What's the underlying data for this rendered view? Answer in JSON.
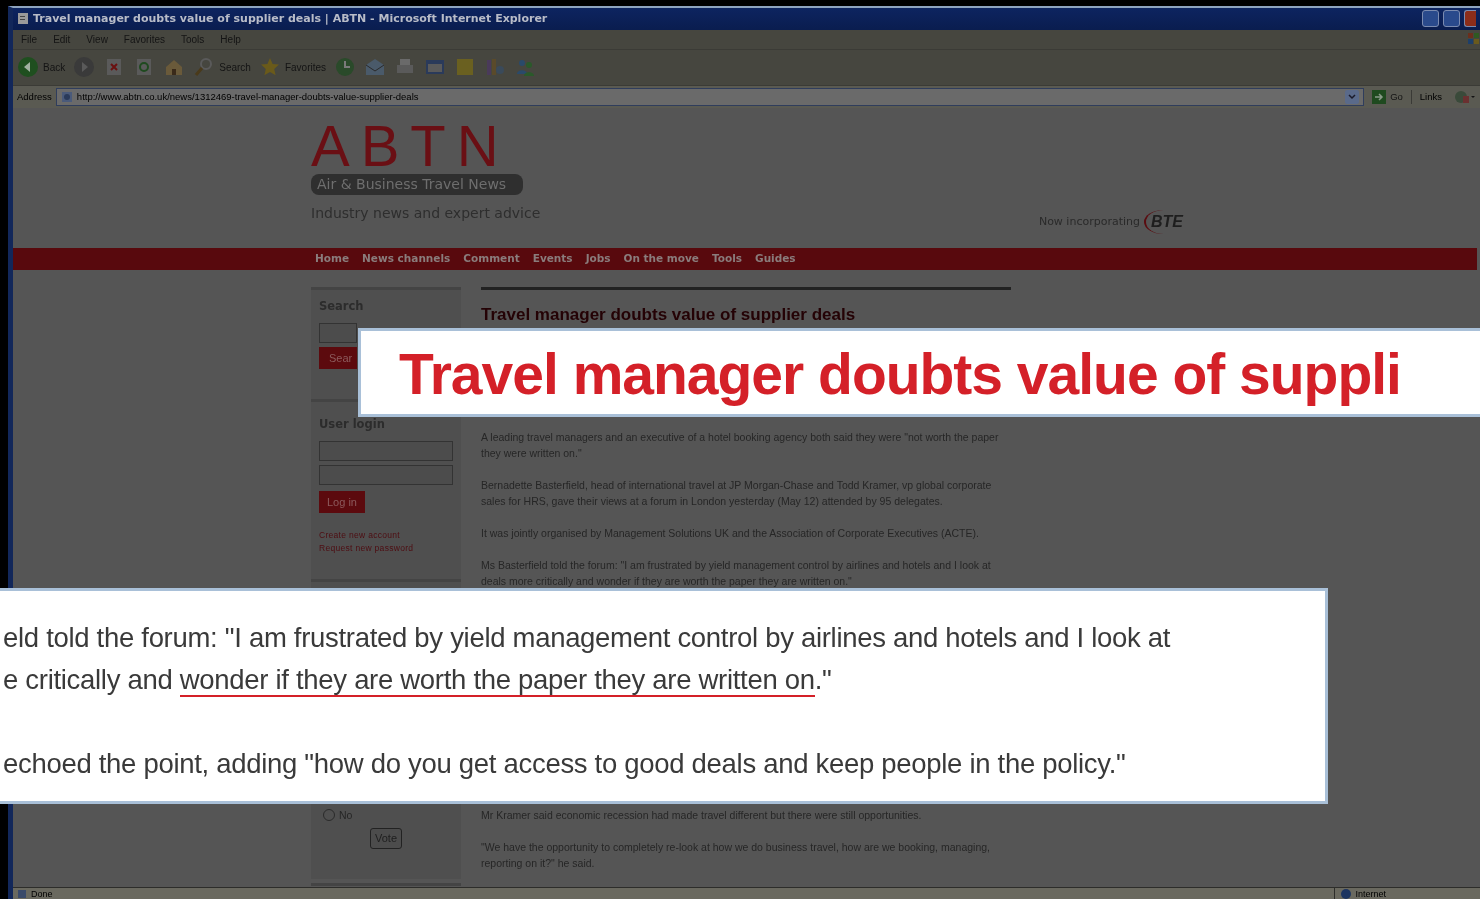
{
  "window": {
    "title": "Travel manager doubts value of supplier deals | ABTN - Microsoft Internet Explorer"
  },
  "menu": [
    "File",
    "Edit",
    "View",
    "Favorites",
    "Tools",
    "Help"
  ],
  "toolbar": [
    {
      "kind": "back",
      "label": "Back"
    },
    {
      "kind": "forward"
    },
    {
      "kind": "stop"
    },
    {
      "kind": "refresh"
    },
    {
      "kind": "home"
    },
    {
      "kind": "search",
      "label": "Search"
    },
    {
      "kind": "favorites",
      "label": "Favorites"
    },
    {
      "kind": "history"
    },
    {
      "kind": "mail"
    },
    {
      "kind": "print"
    },
    {
      "kind": "edit"
    },
    {
      "kind": "note"
    },
    {
      "kind": "research"
    },
    {
      "kind": "messenger"
    }
  ],
  "address_bar": {
    "label": "Address",
    "url": "http://www.abtn.co.uk/news/1312469-travel-manager-doubts-value-supplier-deals",
    "go": "Go",
    "links": "Links"
  },
  "site": {
    "logo": "ABTN",
    "logo_subtitle": "Air & Business Travel News",
    "tagline": "Industry news and expert advice",
    "partner_text": "Now incorporating",
    "partner_logo": "BTE"
  },
  "nav": [
    "Home",
    "News channels",
    "Comment",
    "Events",
    "Jobs",
    "On the move",
    "Tools",
    "Guides"
  ],
  "sidebar": {
    "search": {
      "heading": "Search",
      "button": "Sear"
    },
    "login": {
      "heading": "User login",
      "button": "Log in",
      "links": [
        "Create new account",
        "Request new password"
      ]
    },
    "poll": {
      "option": "No",
      "selected": false,
      "button": "Vote"
    }
  },
  "article": {
    "title": "Travel manager doubts value of supplier deals",
    "paragraphs_top": [
      "A leading travel managers and an executive of a hotel booking agency both said they were \"not worth the paper they were written on.\"",
      "Bernadette Basterfield, head of international travel at JP Morgan-Chase and Todd Kramer, vp global corporate sales for HRS, gave their views at a forum in London yesterday (May 12) attended by 95 delegates.",
      "It was jointly organised by Management Solutions UK and the Association of Corporate Executives (ACTE).",
      "Ms Basterfield told the forum: \"I am frustrated by yield management control by airlines and hotels and I look at deals more critically and wonder if they are worth the paper they are written on.\""
    ],
    "paragraphs_bottom": [
      "Mr Kramer said economic recession had made travel different but there were still opportunities.",
      "\"We have the opportunity to completely re-look at how we do business travel, how are we booking, managing, reporting on it?\" he said."
    ]
  },
  "callouts": [
    {
      "kind": "headline",
      "lines": [
        [
          {
            "text": "Travel manager doubts value of suppli",
            "underlined": false
          }
        ]
      ]
    },
    {
      "kind": "quote",
      "lines": [
        [
          {
            "text": "eld told the forum: \"I am frustrated by yield management control by airlines and hotels and I look at",
            "underlined": false
          }
        ],
        [
          {
            "text": "e critically and ",
            "underlined": false
          },
          {
            "text": "wonder if they are worth the paper they are written on",
            "underlined": true
          },
          {
            "text": ".\"",
            "underlined": false
          }
        ],
        [
          {
            "text": "echoed the point, adding \"how do you get access to good deals and keep people in the policy.\"",
            "underlined": false
          }
        ]
      ]
    }
  ],
  "status_bar": {
    "text": "Done",
    "zone": "Internet"
  }
}
